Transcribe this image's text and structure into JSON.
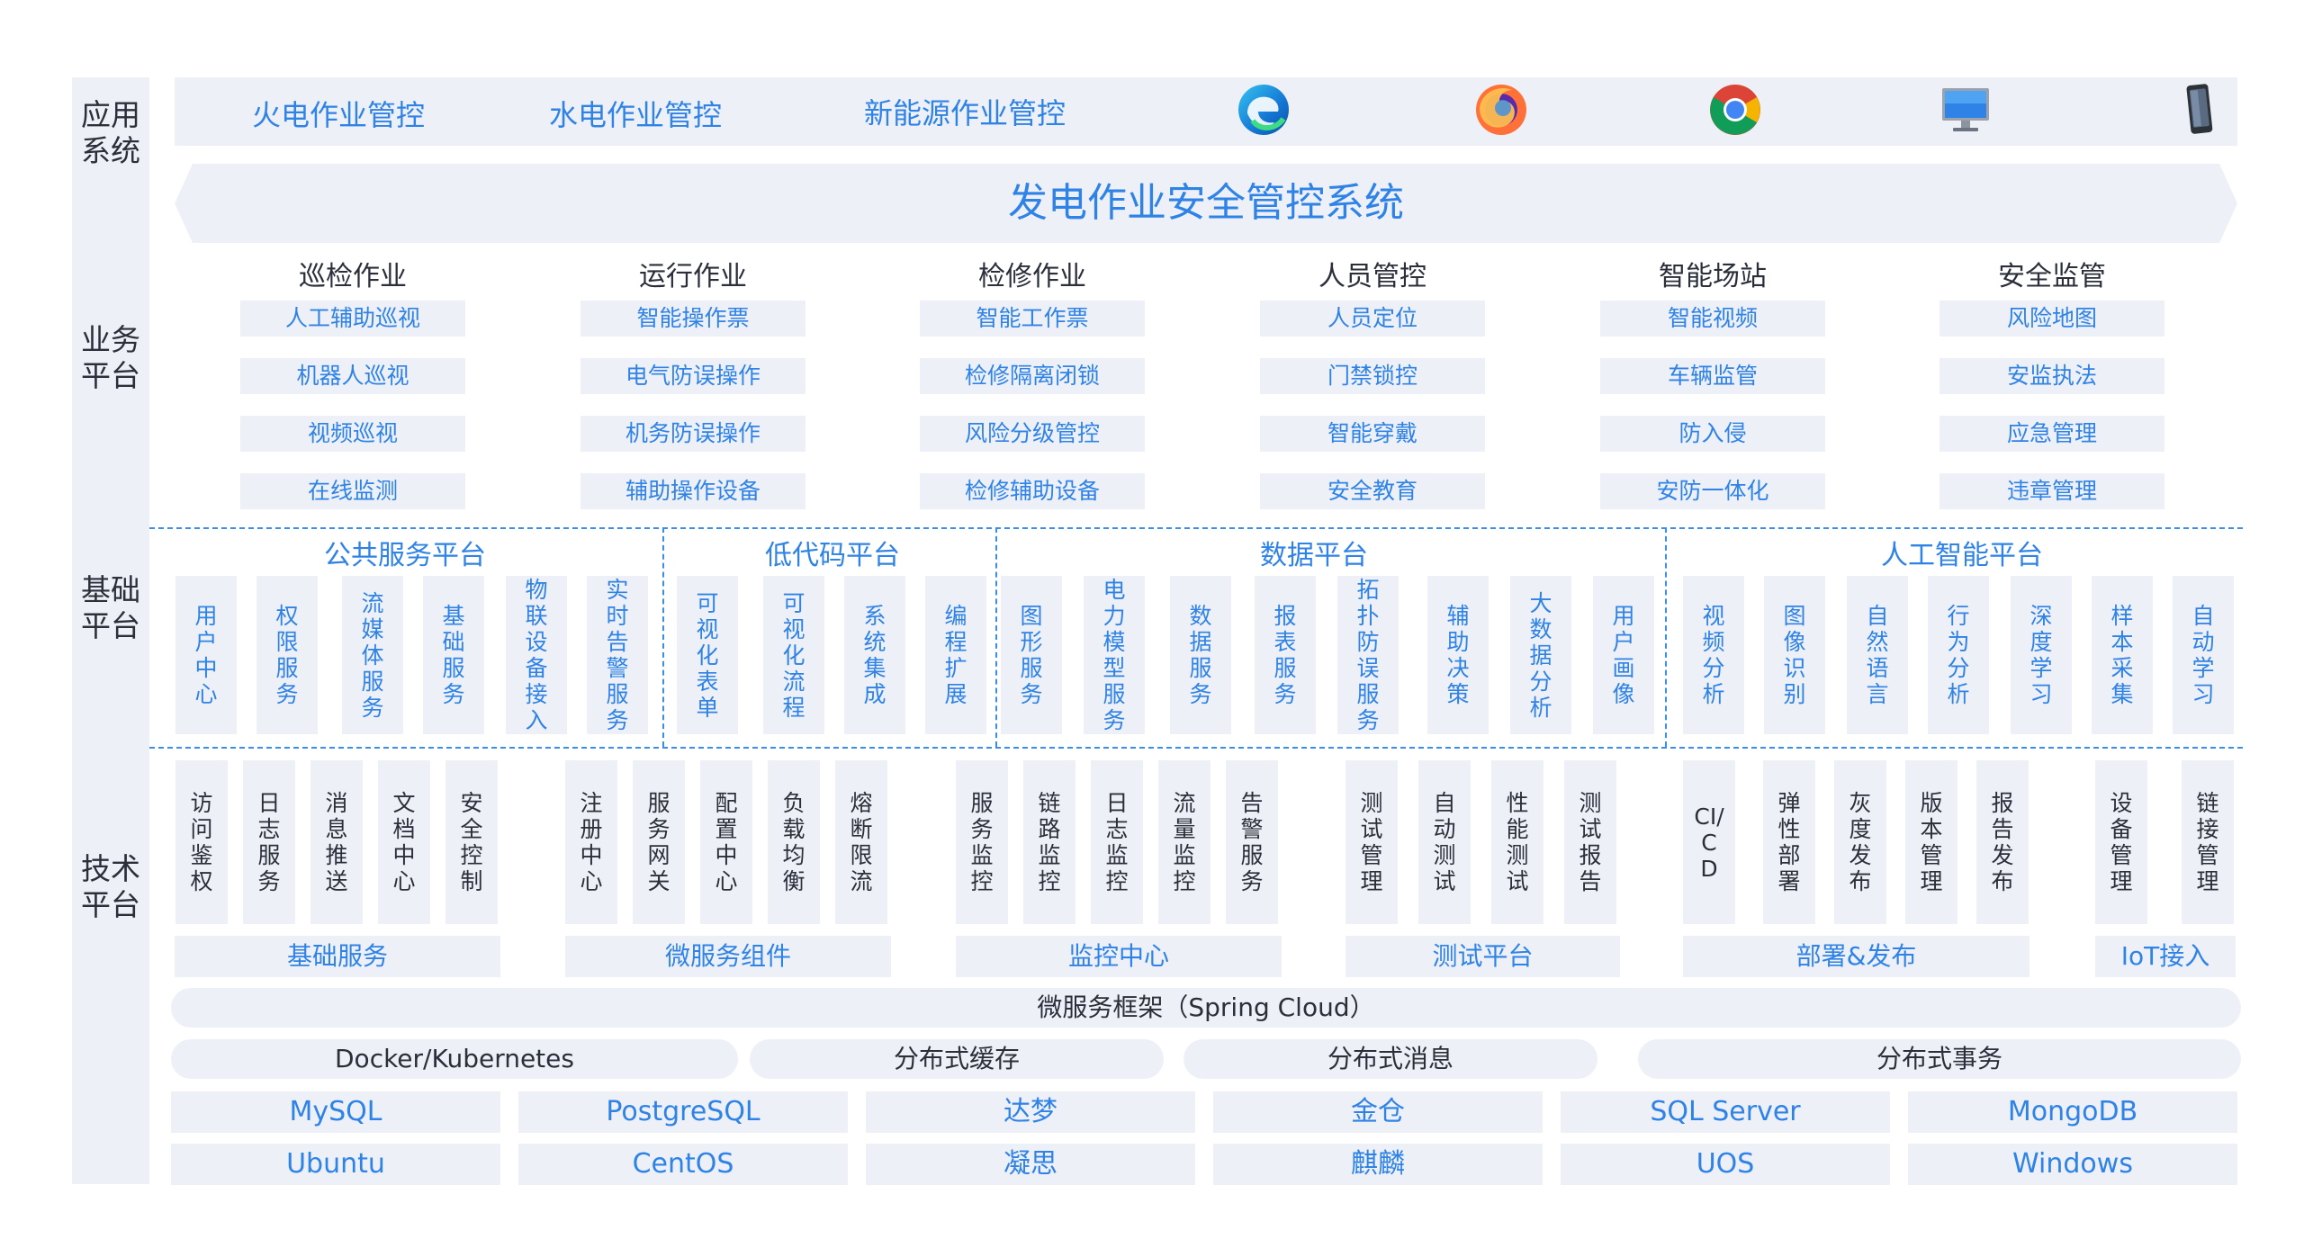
{
  "sidebar": {
    "app": "应用系统",
    "biz": "业务平台",
    "base": "基础平台",
    "tech": "技术平台"
  },
  "apps": {
    "items": [
      "火电作业管控",
      "水电作业管控",
      "新能源作业管控"
    ],
    "icons": [
      "edge-browser-icon",
      "firefox-browser-icon",
      "chrome-browser-icon",
      "desktop-monitor-icon",
      "mobile-phone-icon"
    ]
  },
  "banner": {
    "title": "发电作业安全管控系统"
  },
  "business": {
    "columns": [
      {
        "title": "巡检作业",
        "items": [
          "人工辅助巡视",
          "机器人巡视",
          "视频巡视",
          "在线监测"
        ]
      },
      {
        "title": "运行作业",
        "items": [
          "智能操作票",
          "电气防误操作",
          "机务防误操作",
          "辅助操作设备"
        ]
      },
      {
        "title": "检修作业",
        "items": [
          "智能工作票",
          "检修隔离闭锁",
          "风险分级管控",
          "检修辅助设备"
        ]
      },
      {
        "title": "人员管控",
        "items": [
          "人员定位",
          "门禁锁控",
          "智能穿戴",
          "安全教育"
        ]
      },
      {
        "title": "智能场站",
        "items": [
          "智能视频",
          "车辆监管",
          "防入侵",
          "安防一体化"
        ]
      },
      {
        "title": "安全监管",
        "items": [
          "风险地图",
          "安监执法",
          "应急管理",
          "违章管理"
        ]
      }
    ]
  },
  "foundation": {
    "groups": [
      {
        "title": "公共服务平台",
        "items": [
          "用户中心",
          "权限服务",
          "流媒体服务",
          "基础服务",
          "物联设备接入",
          "实时告警服务"
        ]
      },
      {
        "title": "低代码平台",
        "items": [
          "可视化表单",
          "可视化流程",
          "系统集成",
          "编程扩展"
        ]
      },
      {
        "title": "数据平台",
        "items": [
          "图形服务",
          "电力模型服务",
          "数据服务",
          "报表服务",
          "拓扑防误服务",
          "辅助决策",
          "大数据分析",
          "用户画像"
        ]
      },
      {
        "title": "人工智能平台",
        "items": [
          "视频分析",
          "图像识别",
          "自然语言",
          "行为分析",
          "深度学习",
          "样本采集",
          "自动学习"
        ]
      }
    ]
  },
  "tech": {
    "groups": [
      {
        "title": "基础服务",
        "items": [
          "访问鉴权",
          "日志服务",
          "消息推送",
          "文档中心",
          "安全控制"
        ]
      },
      {
        "title": "微服务组件",
        "items": [
          "注册中心",
          "服务网关",
          "配置中心",
          "负载均衡",
          "熔断限流"
        ]
      },
      {
        "title": "监控中心",
        "items": [
          "服务监控",
          "链路监控",
          "日志监控",
          "流量监控",
          "告警服务"
        ]
      },
      {
        "title": "测试平台",
        "items": [
          "测试管理",
          "自动测试",
          "性能测试",
          "测试报告"
        ]
      },
      {
        "title": "部署&发布",
        "items": [
          "CI/CD",
          "弹性部署",
          "灰度发布",
          "版本管理",
          "报告发布"
        ]
      },
      {
        "title": "IoT接入",
        "items": [
          "设备管理",
          "链接管理"
        ]
      }
    ],
    "framework": "微服务框架（Spring Cloud）",
    "middleware": [
      "Docker/Kubernetes",
      "分布式缓存",
      "分布式消息",
      "分布式事务"
    ],
    "databases": [
      "MySQL",
      "PostgreSQL",
      "达梦",
      "金仓",
      "SQL Server",
      "MongoDB"
    ],
    "os": [
      "Ubuntu",
      "CentOS",
      "凝思",
      "麒麟",
      "UOS",
      "Windows"
    ]
  }
}
